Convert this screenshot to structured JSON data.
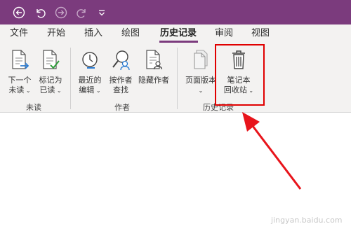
{
  "tabs": [
    "文件",
    "开始",
    "插入",
    "绘图",
    "历史记录",
    "审阅",
    "视图"
  ],
  "active_tab_index": 4,
  "ribbon": {
    "next_unread": {
      "line1": "下一个",
      "line2": "未读"
    },
    "mark_as_read": {
      "line1": "标记为",
      "line2": "已读"
    },
    "recent_edits": {
      "line1": "最近的",
      "line2": "编辑"
    },
    "find_by_author": {
      "line1": "按作者",
      "line2": "查找"
    },
    "hide_authors": {
      "line1": "隐藏作者"
    },
    "page_versions": {
      "line1": "页面版本"
    },
    "notebook_recycle_bin": {
      "line1": "笔记本",
      "line2": "回收站"
    },
    "group_unread": "未读",
    "group_authors": "作者",
    "group_history": "历史记录"
  },
  "colors": {
    "titlebar": "#7b3b7d",
    "highlight": "#e00000"
  },
  "watermark": "jingyan.baidu.com"
}
